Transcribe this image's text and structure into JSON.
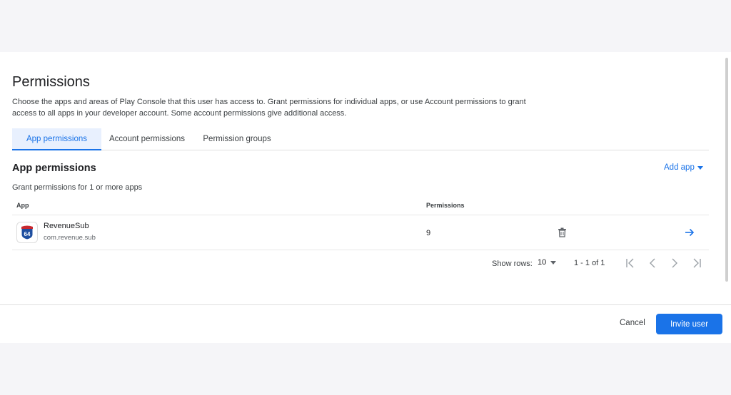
{
  "page": {
    "title": "Permissions",
    "description": "Choose the apps and areas of Play Console that this user has access to. Grant permissions for individual apps, or use Account permissions to grant access to all apps in your developer account. Some account permissions give additional access."
  },
  "tabs": [
    {
      "label": "App permissions",
      "active": true
    },
    {
      "label": "Account permissions",
      "active": false
    },
    {
      "label": "Permission groups",
      "active": false
    }
  ],
  "section": {
    "title": "App permissions",
    "subtitle": "Grant permissions for 1 or more apps",
    "add_label": "Add app"
  },
  "table": {
    "columns": [
      "App",
      "Permissions"
    ],
    "rows": [
      {
        "name": "RevenueSub",
        "package": "com.revenue.sub",
        "permissions": "9",
        "icon_text": "64"
      }
    ]
  },
  "pagination": {
    "show_rows_label": "Show rows:",
    "rows_value": "10",
    "range": "1 - 1 of 1"
  },
  "footer": {
    "cancel_label": "Cancel",
    "invite_label": "Invite user"
  },
  "colors": {
    "accent": "#1a73e8",
    "tab_active_bg": "#e8f0fe"
  }
}
